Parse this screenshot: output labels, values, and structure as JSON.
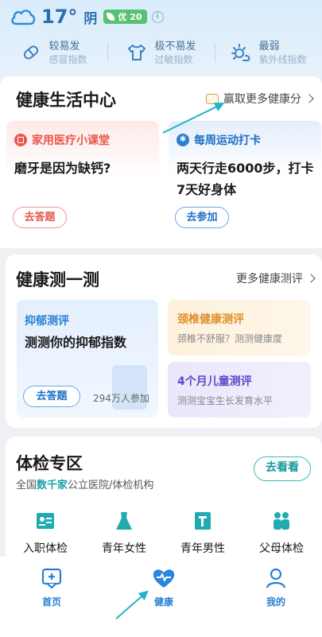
{
  "weather": {
    "temperature": "17°",
    "condition": "阴",
    "aqi": "优 20",
    "indices": [
      {
        "level": "较易发",
        "name": "感冒指数",
        "icon": "pill-icon"
      },
      {
        "level": "极不易发",
        "name": "过敏指数",
        "icon": "shirt-icon"
      },
      {
        "level": "最弱",
        "name": "紫外线指数",
        "icon": "sun-icon"
      }
    ]
  },
  "health_center": {
    "title": "健康生活中心",
    "link": "赢取更多健康分",
    "cards": [
      {
        "tag": "家用医疗小课堂",
        "body": "磨牙是因为缺钙?",
        "button": "去答题"
      },
      {
        "tag": "每周运动打卡",
        "body": "两天行走6000步，打卡7天好身体",
        "button": "去参加"
      }
    ]
  },
  "health_test": {
    "title": "健康测一测",
    "link": "更多健康测评",
    "depression": {
      "tag": "抑郁测评",
      "body": "测测你的抑郁指数",
      "button": "去答题",
      "count": "294万人参加"
    },
    "neck": {
      "title": "颈椎健康测评",
      "desc": "颈椎不舒服？测测健康度"
    },
    "child": {
      "title": "4个月儿童测评",
      "desc": "测测宝宝生长发育水平"
    }
  },
  "checkup": {
    "title": "体检专区",
    "subtitle_prefix": "全国",
    "subtitle_highlight": "数千家",
    "subtitle_suffix": "公立医院/体检机构",
    "button": "去看看",
    "items": [
      {
        "label": "入职体检",
        "icon": "id-card-icon"
      },
      {
        "label": "青年女性",
        "icon": "dress-icon"
      },
      {
        "label": "青年男性",
        "icon": "male-icon"
      },
      {
        "label": "父母体检",
        "icon": "parents-icon"
      }
    ]
  },
  "tabbar": {
    "items": [
      {
        "label": "首页",
        "icon": "home-icon"
      },
      {
        "label": "健康",
        "icon": "heart-pulse-icon"
      },
      {
        "label": "我的",
        "icon": "person-icon"
      }
    ]
  },
  "colors": {
    "accent": "#2a8bd8",
    "teal": "#16a3a8",
    "red": "#e8584b",
    "orange": "#e59a2e",
    "purple": "#6c5bd4"
  }
}
